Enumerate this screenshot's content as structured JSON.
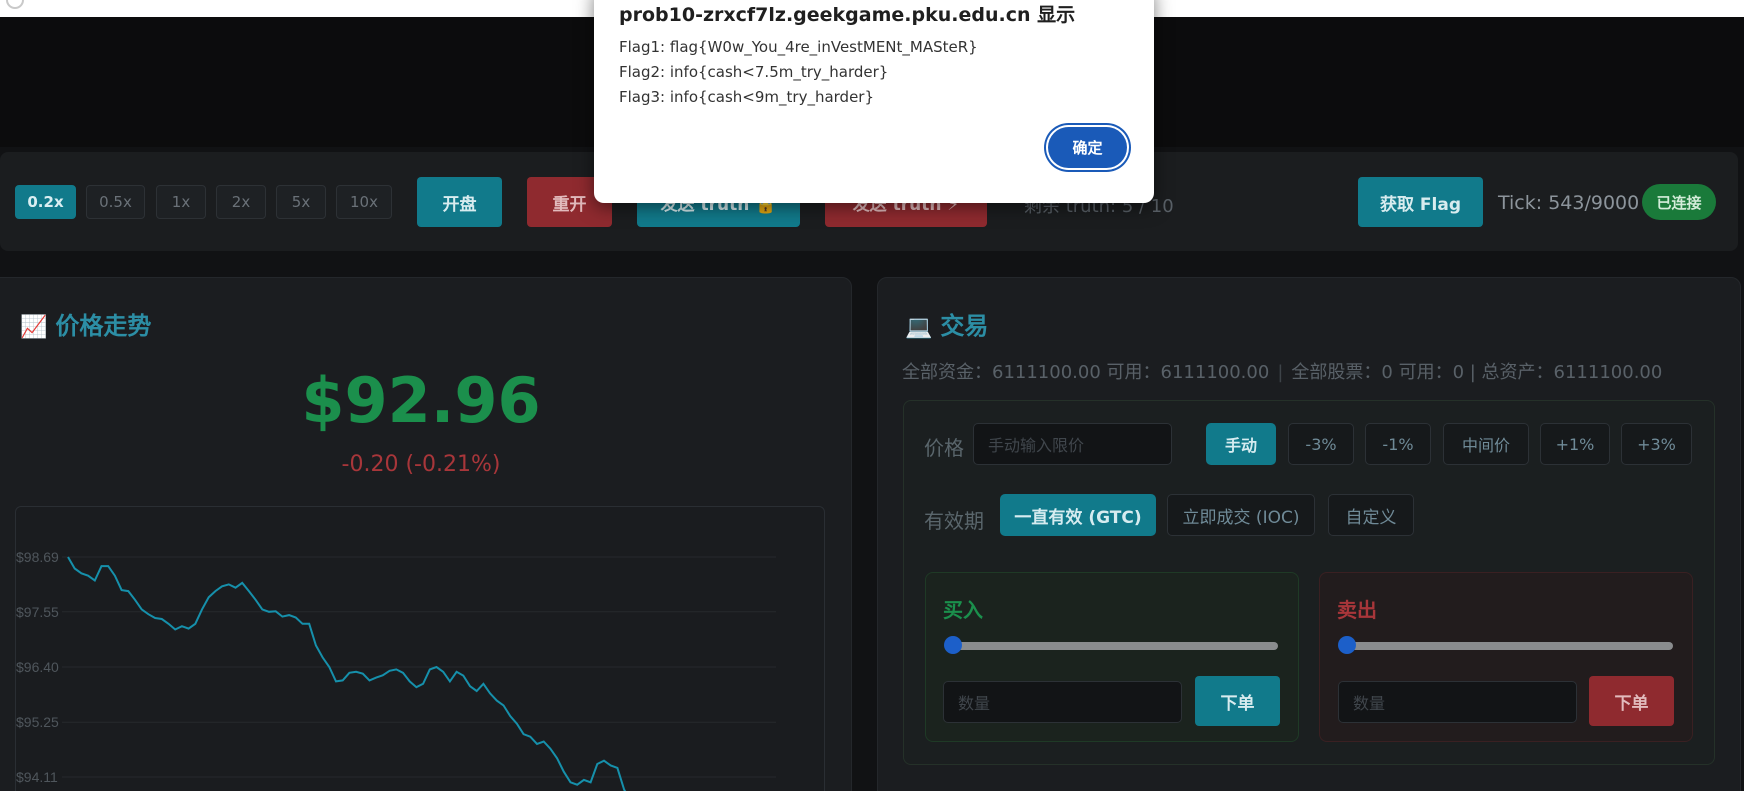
{
  "toolbar": {
    "speeds": [
      "0.2x",
      "0.5x",
      "1x",
      "2x",
      "5x",
      "10x"
    ],
    "active_speed": "0.2x",
    "open_label": "开盘",
    "reset_label": "重开",
    "send_truth_1": "发送 truth 🔒",
    "send_truth_2": "发送 truth ⚡",
    "remaining": "剩余 truth: 5 / 10",
    "get_flag_label": "获取 Flag",
    "tick": "Tick: 543/9000",
    "status": "已连接"
  },
  "price_panel": {
    "icon": "chart-up-icon",
    "title": "价格走势",
    "price": "$92.96",
    "change": "-0.20 (-0.21%)"
  },
  "chart_data": {
    "type": "line",
    "ylabels": [
      "$98.69",
      "$97.55",
      "$96.40",
      "$95.25",
      "$94.11"
    ],
    "ylim": [
      93.5,
      99.1
    ],
    "values": [
      98.69,
      98.45,
      98.35,
      98.3,
      98.2,
      98.5,
      98.5,
      98.3,
      98.0,
      97.98,
      97.8,
      97.6,
      97.5,
      97.42,
      97.4,
      97.3,
      97.18,
      97.25,
      97.2,
      97.3,
      97.6,
      97.85,
      97.98,
      98.08,
      98.12,
      98.05,
      98.15,
      97.98,
      97.8,
      97.6,
      97.55,
      97.56,
      97.45,
      97.48,
      97.43,
      97.3,
      97.3,
      96.85,
      96.6,
      96.4,
      96.1,
      96.12,
      96.28,
      96.3,
      96.26,
      96.12,
      96.18,
      96.23,
      96.32,
      96.35,
      96.28,
      96.1,
      95.98,
      96.05,
      96.35,
      96.4,
      96.3,
      96.1,
      96.3,
      96.22,
      96.0,
      95.9,
      96.05,
      95.85,
      95.7,
      95.6,
      95.38,
      95.22,
      95.0,
      94.95,
      94.8,
      94.85,
      94.7,
      94.5,
      94.22,
      94.0,
      93.95,
      94.05,
      94.0,
      94.38,
      94.45,
      94.35,
      94.3,
      93.85,
      93.6
    ]
  },
  "trade_panel": {
    "icon": "laptop-icon",
    "title": "交易",
    "funds": "全部资金：6111100.00 可用：6111100.00",
    "stocks": "全部股票：0 可用：0 | 总资产：6111100.00",
    "price_label": "价格",
    "price_placeholder": "手动输入限价",
    "price_buttons": [
      "手动",
      "-3%",
      "-1%",
      "中间价",
      "+1%",
      "+3%"
    ],
    "validity_label": "有效期",
    "validity_options": [
      "一直有效 (GTC)",
      "立即成交 (IOC)",
      "自定义"
    ],
    "buy": {
      "title": "买入",
      "qty_placeholder": "数量",
      "order_label": "下单"
    },
    "sell": {
      "title": "卖出",
      "qty_placeholder": "数量",
      "order_label": "下单"
    }
  },
  "dialog": {
    "title": "prob10-zrxcf7lz.geekgame.pku.edu.cn 显示",
    "lines": [
      "Flag1: flag{W0w_You_4re_inVestMENt_MASteR}",
      "Flag2: info{cash<7.5m_try_harder}",
      "Flag3: info{cash<9m_try_harder}"
    ],
    "ok_label": "确定"
  },
  "colors": {
    "accent": "#117a8b",
    "danger": "#8f2a2f",
    "up": "#1b8f4c",
    "down": "#a8363a",
    "line": "#1690ab"
  }
}
